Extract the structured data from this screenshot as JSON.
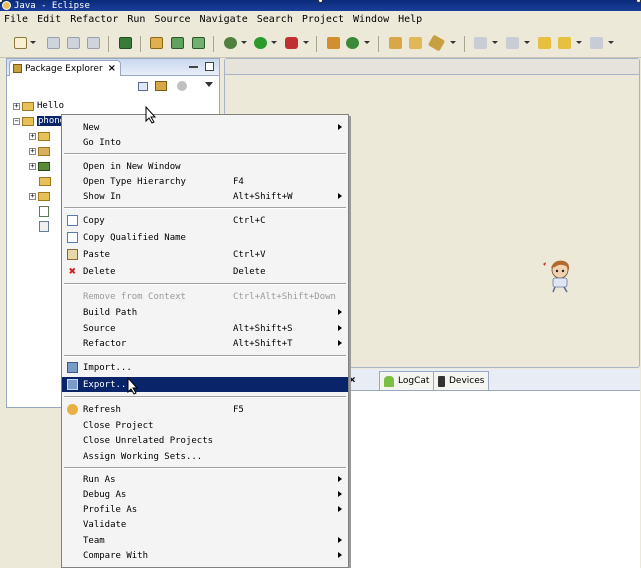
{
  "window": {
    "title": "Java - Eclipse"
  },
  "menubar": [
    "File",
    "Edit",
    "Refactor",
    "Run",
    "Source",
    "Navigate",
    "Search",
    "Project",
    "Window",
    "Help"
  ],
  "package_explorer": {
    "tab_title": "Package Explorer",
    "tree": [
      {
        "label": "Hello",
        "expanded": false
      },
      {
        "label": "phone",
        "expanded": true,
        "selected": true
      }
    ]
  },
  "bottom_tabs": [
    {
      "label": "LogCat",
      "icon": "android-icon"
    },
    {
      "label": "Devices",
      "icon": "phone-icon"
    }
  ],
  "context_menu": {
    "items": [
      {
        "label": "New",
        "accel": "",
        "submenu": true,
        "icon": ""
      },
      {
        "label": "Go Into",
        "accel": "",
        "submenu": false,
        "icon": ""
      },
      {
        "sep": true
      },
      {
        "label": "Open in New Window",
        "accel": "",
        "submenu": false,
        "icon": ""
      },
      {
        "label": "Open Type Hierarchy",
        "accel": "F4",
        "submenu": false,
        "icon": ""
      },
      {
        "label": "Show In",
        "accel": "Alt+Shift+W",
        "submenu": true,
        "icon": ""
      },
      {
        "sep": true
      },
      {
        "label": "Copy",
        "accel": "Ctrl+C",
        "submenu": false,
        "icon": "copy-icon"
      },
      {
        "label": "Copy Qualified Name",
        "accel": "",
        "submenu": false,
        "icon": "copy-qualified-icon"
      },
      {
        "label": "Paste",
        "accel": "Ctrl+V",
        "submenu": false,
        "icon": "paste-icon"
      },
      {
        "label": "Delete",
        "accel": "Delete",
        "submenu": false,
        "icon": "delete-icon"
      },
      {
        "sep": true
      },
      {
        "label": "Remove from Context",
        "accel": "Ctrl+Alt+Shift+Down",
        "submenu": false,
        "disabled": true,
        "icon": ""
      },
      {
        "label": "Build Path",
        "accel": "",
        "submenu": true,
        "icon": ""
      },
      {
        "label": "Source",
        "accel": "Alt+Shift+S",
        "submenu": true,
        "icon": ""
      },
      {
        "label": "Refactor",
        "accel": "Alt+Shift+T",
        "submenu": true,
        "icon": ""
      },
      {
        "sep": true
      },
      {
        "label": "Import...",
        "accel": "",
        "submenu": false,
        "icon": "import-icon"
      },
      {
        "label": "Export...",
        "accel": "",
        "submenu": false,
        "highlight": true,
        "icon": "export-icon"
      },
      {
        "sep": true
      },
      {
        "label": "Refresh",
        "accel": "F5",
        "submenu": false,
        "icon": "refresh-icon"
      },
      {
        "label": "Close Project",
        "accel": "",
        "submenu": false,
        "icon": ""
      },
      {
        "label": "Close Unrelated Projects",
        "accel": "",
        "submenu": false,
        "icon": ""
      },
      {
        "label": "Assign Working Sets...",
        "accel": "",
        "submenu": false,
        "icon": ""
      },
      {
        "sep": true
      },
      {
        "label": "Run As",
        "accel": "",
        "submenu": true,
        "icon": ""
      },
      {
        "label": "Debug As",
        "accel": "",
        "submenu": true,
        "icon": ""
      },
      {
        "label": "Profile As",
        "accel": "",
        "submenu": true,
        "icon": ""
      },
      {
        "label": "Validate",
        "accel": "",
        "submenu": false,
        "icon": ""
      },
      {
        "label": "Team",
        "accel": "",
        "submenu": true,
        "icon": ""
      },
      {
        "label": "Compare With",
        "accel": "",
        "submenu": true,
        "icon": ""
      }
    ]
  },
  "colors": {
    "selection": "#0a246a",
    "title_bar": "#0a2a7a",
    "panel_bg": "#ece9d8"
  }
}
